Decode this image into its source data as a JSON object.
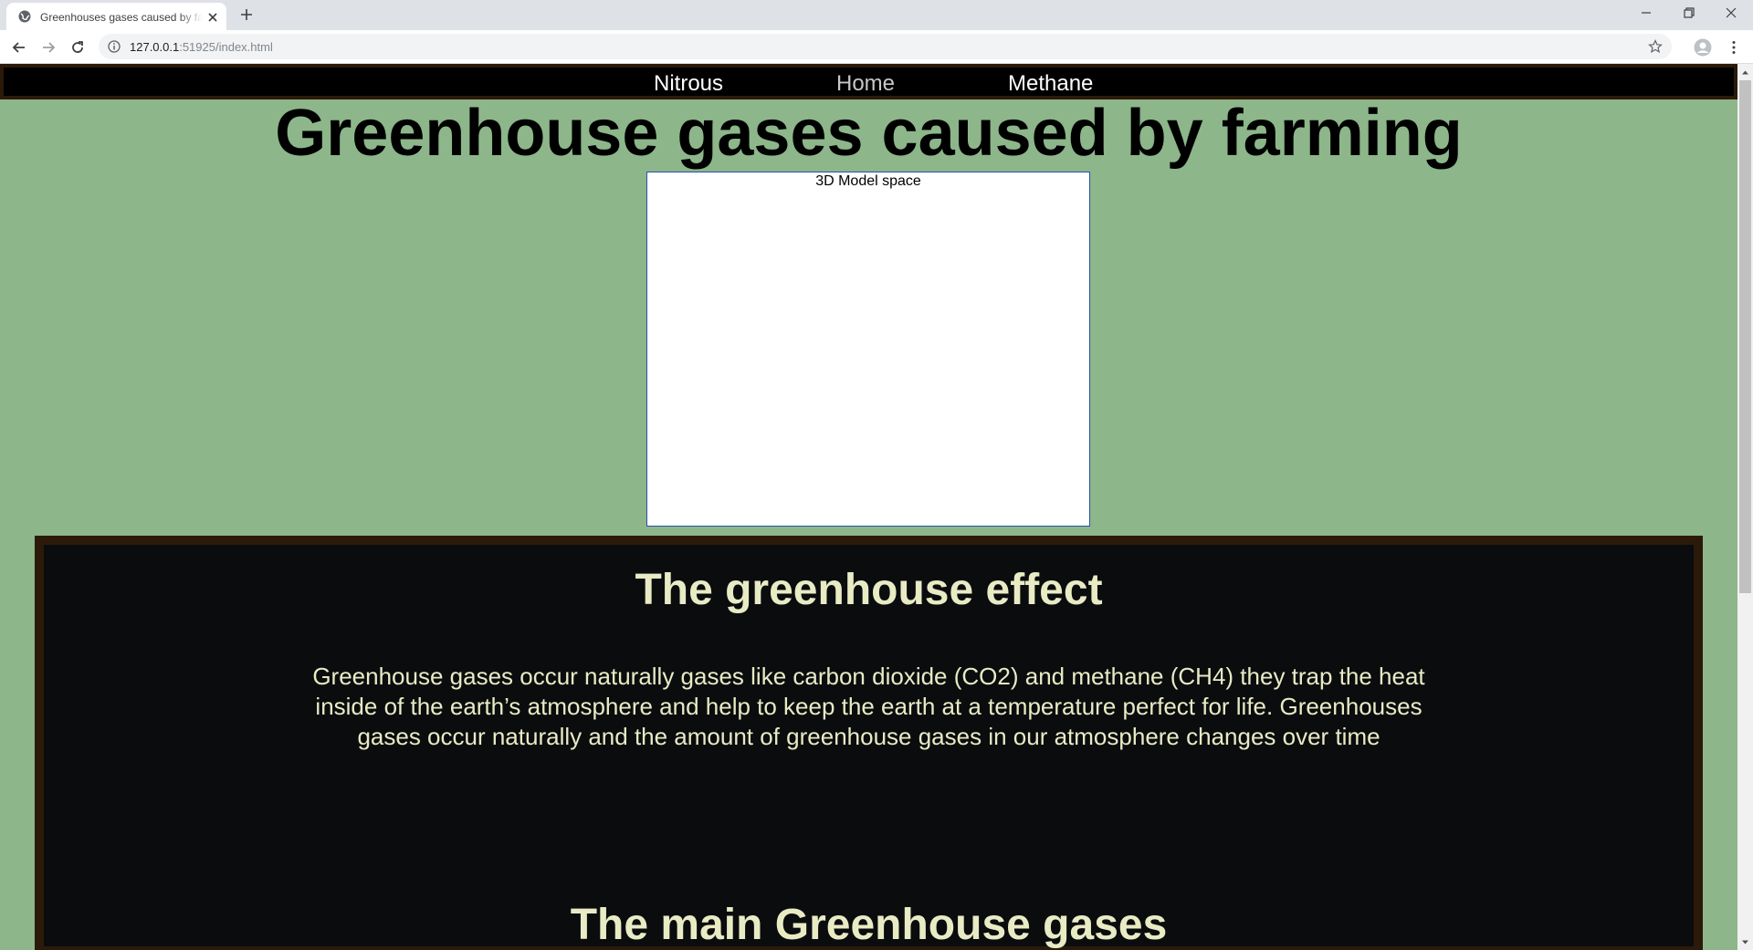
{
  "browser": {
    "tab_title": "Greenhouses gases caused by farming",
    "url_host": "127.0.0.1",
    "url_rest": ":51925/index.html"
  },
  "nav": {
    "items": [
      {
        "label": "Nitrous"
      },
      {
        "label": "Home"
      },
      {
        "label": "Methane"
      }
    ]
  },
  "page": {
    "title": "Greenhouse gases caused by farming",
    "model_label": "3D Model space"
  },
  "section": {
    "heading": "The greenhouse effect",
    "body": "Greenhouse gases occur naturally gases like carbon dioxide (CO2) and methane (CH4) they trap the heat inside of the earth’s atmosphere and help to keep the earth at a temperature perfect for life. Greenhouses gases occur naturally and the amount of greenhouse gases in our atmosphere changes over time",
    "next_heading": "The main Greenhouse gases"
  },
  "colors": {
    "page_bg": "#8db68a",
    "nav_bg": "#000000",
    "panel_bg": "#0b0c0e",
    "panel_border": "#2b1a0a",
    "panel_text": "#e8ebc4"
  }
}
